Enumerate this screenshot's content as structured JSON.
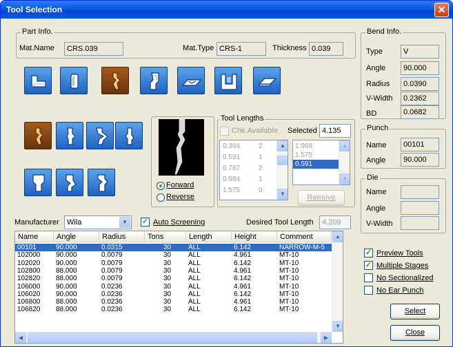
{
  "window": {
    "title": "Tool Selection",
    "close": "✕"
  },
  "part_info": {
    "label": "Part Info.",
    "mat_name_label": "Mat.Name",
    "mat_name_value": "CRS.039",
    "mat_type_label": "Mat.Type",
    "mat_type_value": "CRS-1",
    "thickness_label": "Thickness",
    "thickness_value": "0.039"
  },
  "tool_lengths": {
    "label": "Tool Lengths",
    "chk_available_label": "Chk.Available",
    "selected_label": "Selected",
    "selected_value": "4.135",
    "available": [
      {
        "len": "0.394",
        "qty": "2"
      },
      {
        "len": "0.591",
        "qty": "1"
      },
      {
        "len": "0.787",
        "qty": "2"
      },
      {
        "len": "0.984",
        "qty": "1"
      },
      {
        "len": "1.575",
        "qty": "0"
      }
    ],
    "selected_list": [
      "1.969",
      "1.575",
      "0.591"
    ],
    "remove_label": "Remove"
  },
  "direction": {
    "forward_label": "Forward",
    "reverse_label": "Reverse",
    "selected": "forward"
  },
  "manufacturer": {
    "label": "Manufacturer",
    "value": "Wila"
  },
  "auto_screening": {
    "label": "Auto Screening",
    "checked": true
  },
  "desired_length": {
    "label": "Desired Tool Length",
    "value": "4.209"
  },
  "table": {
    "columns": [
      "Name",
      "Angle",
      "Radius",
      "Tons",
      "Length",
      "Height",
      "Comment"
    ],
    "rows": [
      [
        "00101",
        "90.000",
        "0.0315",
        "30",
        "ALL",
        "6.142",
        "NARROW-M-5"
      ],
      [
        "102000",
        "90.000",
        "0.0079",
        "30",
        "ALL",
        "4.961",
        "MT-10"
      ],
      [
        "102020",
        "90.000",
        "0.0079",
        "30",
        "ALL",
        "6.142",
        "MT-10"
      ],
      [
        "102800",
        "88.000",
        "0.0079",
        "30",
        "ALL",
        "4.961",
        "MT-10"
      ],
      [
        "102820",
        "88.000",
        "0.0079",
        "30",
        "ALL",
        "6.142",
        "MT-10"
      ],
      [
        "106000",
        "90.000",
        "0.0236",
        "30",
        "ALL",
        "4.961",
        "MT-10"
      ],
      [
        "106020",
        "90.000",
        "0.0236",
        "30",
        "ALL",
        "6.142",
        "MT-10"
      ],
      [
        "106800",
        "88.000",
        "0.0236",
        "30",
        "ALL",
        "4.961",
        "MT-10"
      ],
      [
        "106820",
        "88.000",
        "0.0236",
        "30",
        "ALL",
        "6.142",
        "MT-10"
      ]
    ]
  },
  "bend_info": {
    "label": "Bend Info.",
    "type_label": "Type",
    "type_value": "V",
    "angle_label": "Angle",
    "angle_value": "90.000",
    "radius_label": "Radius",
    "radius_value": "0.0390",
    "vwidth_label": "V-Width",
    "vwidth_value": "0.2362",
    "bd_label": "BD",
    "bd_value": "0.0682"
  },
  "punch": {
    "label": "Punch",
    "name_label": "Name",
    "name_value": "00101",
    "angle_label": "Angle",
    "angle_value": "90.000"
  },
  "die": {
    "label": "Die",
    "name_label": "Name",
    "name_value": "",
    "angle_label": "Angle",
    "angle_value": "",
    "vwidth_label": "V-Width",
    "vwidth_value": ""
  },
  "options": {
    "preview_tools": {
      "label": "Preview Tools",
      "checked": true
    },
    "multiple_stages": {
      "label": "Multiple Stages",
      "checked": true
    },
    "no_sectionalized": {
      "label": "No Sectionalized",
      "checked": false
    },
    "no_ear_punch": {
      "label": "No Ear Punch",
      "checked": false
    }
  },
  "buttons": {
    "select": "Select",
    "close": "Close"
  },
  "colors": {
    "title_bar": "#0A5BE0",
    "dialog_bg": "#ECE9D8",
    "selection": "#316AC5",
    "tool_button": "#2F76D2",
    "tool_button_selected": "#8A4A17"
  }
}
